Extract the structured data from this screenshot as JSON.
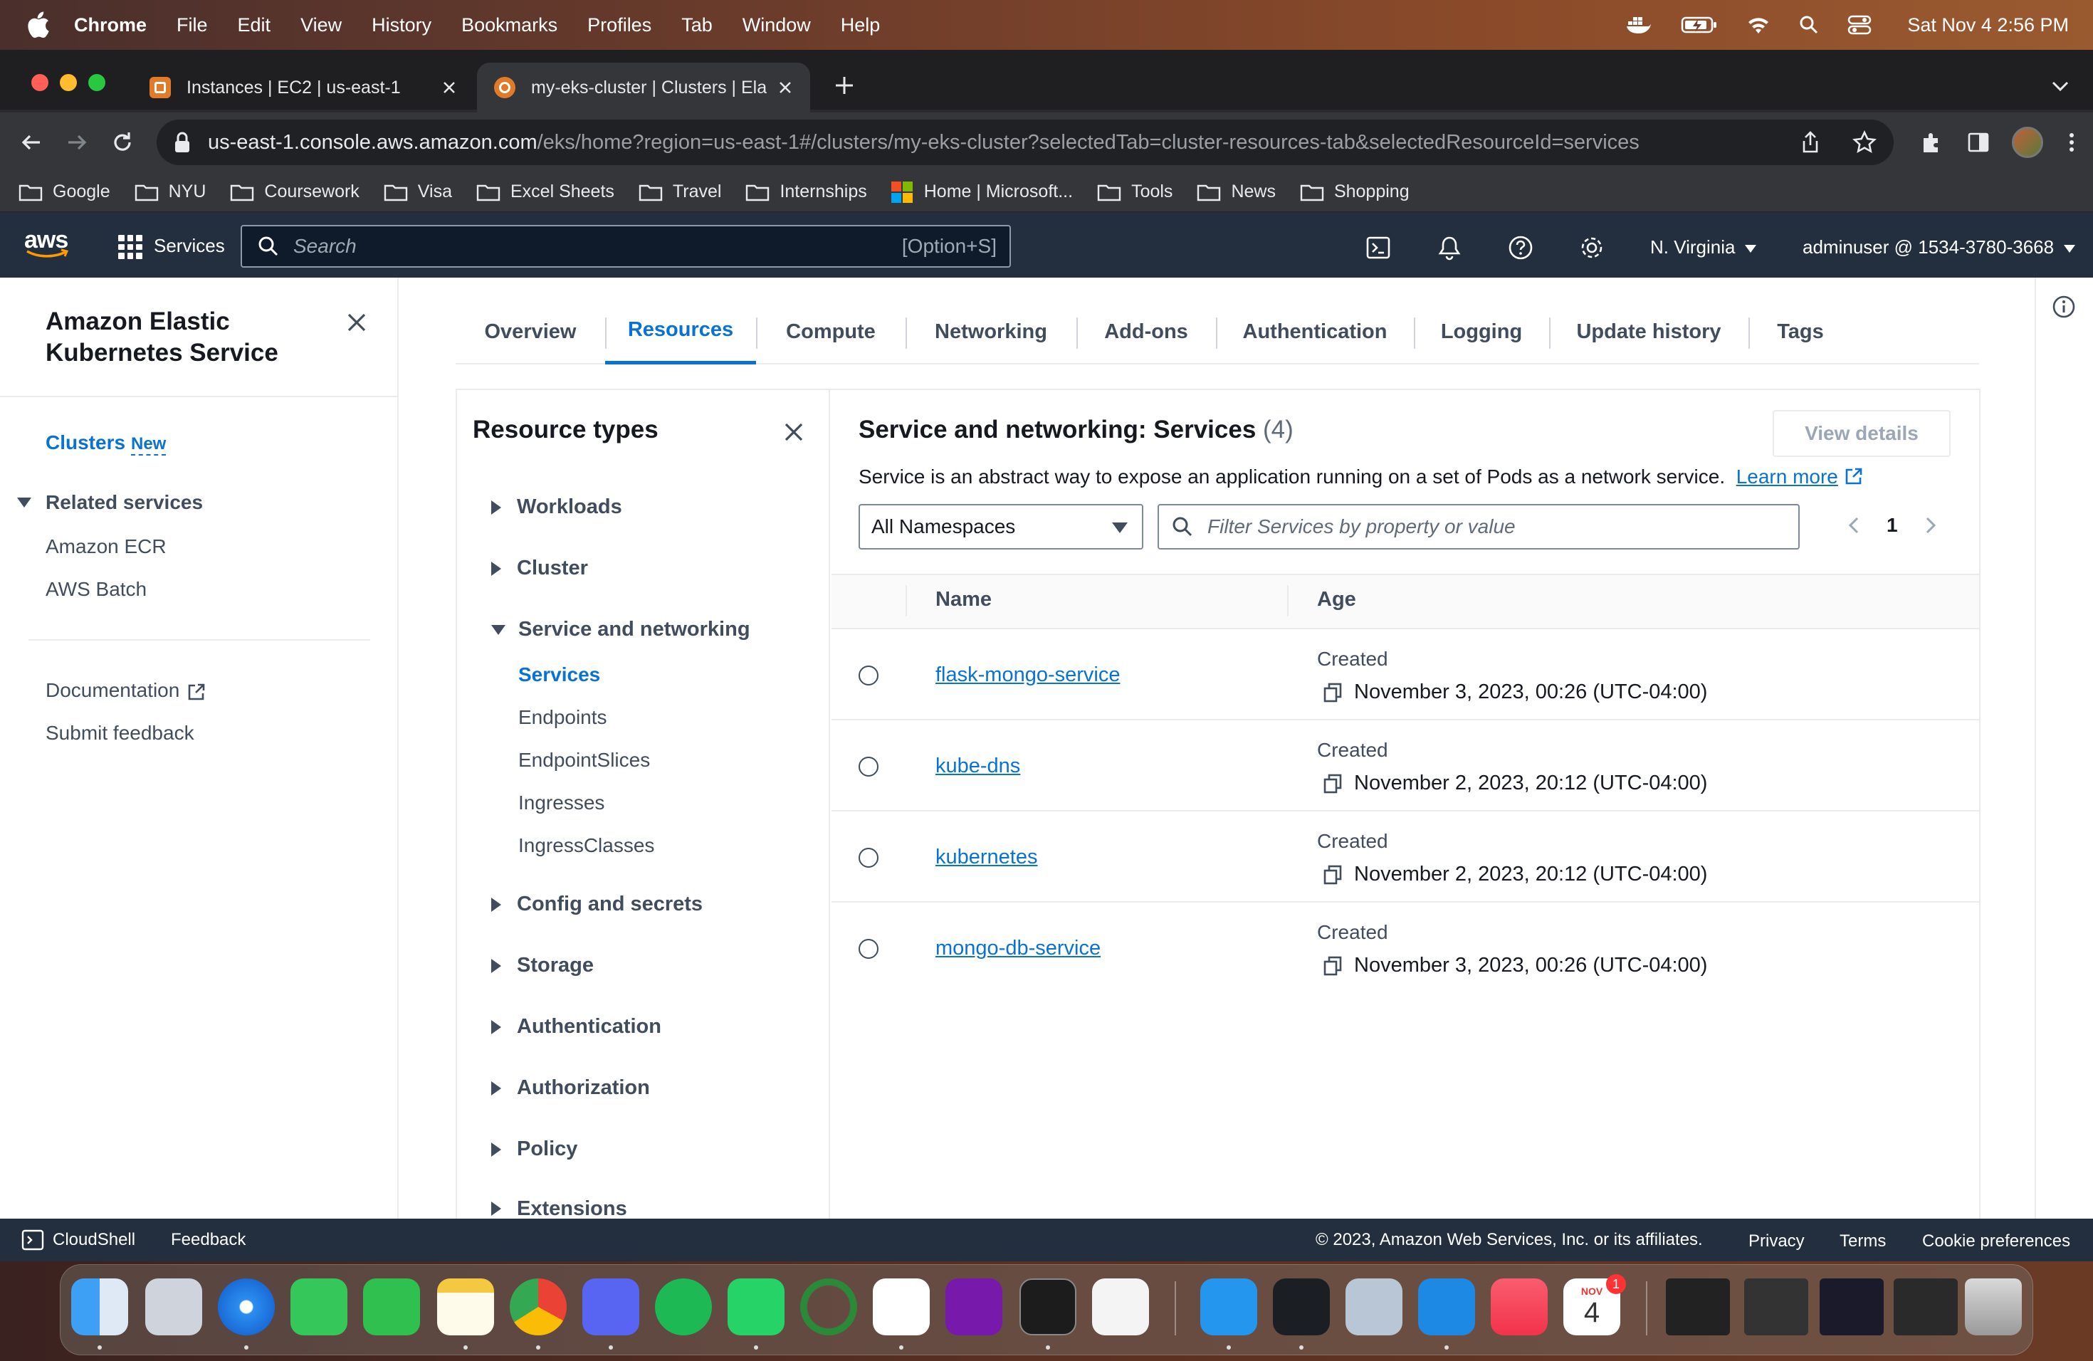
{
  "menubar": {
    "app": "Chrome",
    "items": [
      "File",
      "Edit",
      "View",
      "History",
      "Bookmarks",
      "Profiles",
      "Tab",
      "Window",
      "Help"
    ],
    "datetime": "Sat Nov 4  2:56 PM"
  },
  "browser": {
    "tabs": [
      {
        "title": "Instances | EC2 | us-east-1"
      },
      {
        "title": "my-eks-cluster | Clusters | Ela"
      }
    ],
    "url_host": "us-east-1.console.aws.amazon.com",
    "url_path": "/eks/home?region=us-east-1#/clusters/my-eks-cluster?selectedTab=cluster-resources-tab&selectedResourceId=services",
    "bookmarks": [
      "Google",
      "NYU",
      "Coursework",
      "Visa",
      "Excel Sheets",
      "Travel",
      "Internships",
      "Home | Microsoft...",
      "Tools",
      "News",
      "Shopping"
    ]
  },
  "aws_nav": {
    "logo": "aws",
    "services_label": "Services",
    "search_placeholder": "Search",
    "search_shortcut": "[Option+S]",
    "region": "N. Virginia",
    "account": "adminuser @ 1534-3780-3668"
  },
  "sidebar": {
    "title": "Amazon Elastic Kubernetes Service",
    "clusters": "Clusters",
    "new_badge": "New",
    "related_services": "Related services",
    "related": [
      "Amazon ECR",
      "AWS Batch"
    ],
    "documentation": "Documentation",
    "feedback": "Submit feedback"
  },
  "tabs": [
    "Overview",
    "Resources",
    "Compute",
    "Networking",
    "Add-ons",
    "Authentication",
    "Logging",
    "Update history",
    "Tags"
  ],
  "resource_types": {
    "title": "Resource types",
    "groups": [
      "Workloads",
      "Cluster",
      "Service and networking",
      "Config and secrets",
      "Storage",
      "Authentication",
      "Authorization",
      "Policy",
      "Extensions"
    ],
    "service_networking_items": [
      "Services",
      "Endpoints",
      "EndpointSlices",
      "Ingresses",
      "IngressClasses"
    ]
  },
  "services": {
    "title": "Service and networking: Services",
    "count": "(4)",
    "view_details": "View details",
    "description": "Service is an abstract way to expose an application running on a set of Pods as a network service.",
    "learn_more": "Learn more",
    "namespace": "All Namespaces",
    "filter_placeholder": "Filter Services by property or value",
    "page": "1",
    "col_name": "Name",
    "col_age": "Age",
    "rows": [
      {
        "name": "flask-mongo-service",
        "created_label": "Created",
        "date": "November 3, 2023, 00:26 (UTC-04:00)"
      },
      {
        "name": "kube-dns",
        "created_label": "Created",
        "date": "November 2, 2023, 20:12 (UTC-04:00)"
      },
      {
        "name": "kubernetes",
        "created_label": "Created",
        "date": "November 2, 2023, 20:12 (UTC-04:00)"
      },
      {
        "name": "mongo-db-service",
        "created_label": "Created",
        "date": "November 3, 2023, 00:26 (UTC-04:00)"
      }
    ]
  },
  "footer": {
    "cloudshell": "CloudShell",
    "feedback": "Feedback",
    "copyright": "© 2023, Amazon Web Services, Inc. or its affiliates.",
    "privacy": "Privacy",
    "terms": "Terms",
    "cookies": "Cookie preferences"
  },
  "dock": {
    "calendar_month": "NOV",
    "calendar_day": "4",
    "badge": "1"
  }
}
